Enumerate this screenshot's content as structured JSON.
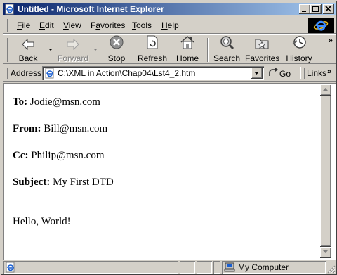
{
  "window": {
    "title": "Untitled - Microsoft Internet Explorer"
  },
  "menu": {
    "items": [
      {
        "label": "File",
        "accel": "F",
        "rest": "ile"
      },
      {
        "label": "Edit",
        "accel": "E",
        "rest": "dit"
      },
      {
        "label": "View",
        "accel": "V",
        "rest": "iew"
      },
      {
        "label": "Favorites",
        "accel": "a",
        "pre": "F",
        "rest": "vorites"
      },
      {
        "label": "Tools",
        "accel": "T",
        "rest": "ools"
      },
      {
        "label": "Help",
        "accel": "H",
        "rest": "elp"
      }
    ]
  },
  "toolbar": {
    "back": "Back",
    "forward": "Forward",
    "stop": "Stop",
    "refresh": "Refresh",
    "home": "Home",
    "search": "Search",
    "favorites": "Favorites",
    "history": "History",
    "more": "»"
  },
  "address": {
    "label": "Address",
    "value": "C:\\XML in Action\\Chap04\\Lst4_2.htm",
    "go": "Go",
    "links": "Links",
    "more": "»"
  },
  "document": {
    "to_label": "To:",
    "to_value": "Jodie@msn.com",
    "from_label": "From:",
    "from_value": "Bill@msn.com",
    "cc_label": "Cc:",
    "cc_value": "Philip@msn.com",
    "subject_label": "Subject:",
    "subject_value": "My First DTD",
    "body": "Hello, World!"
  },
  "status": {
    "zone": "My Computer"
  },
  "colors": {
    "title_start": "#0a246a",
    "title_end": "#a6caf0",
    "face": "#d4d0c8"
  }
}
